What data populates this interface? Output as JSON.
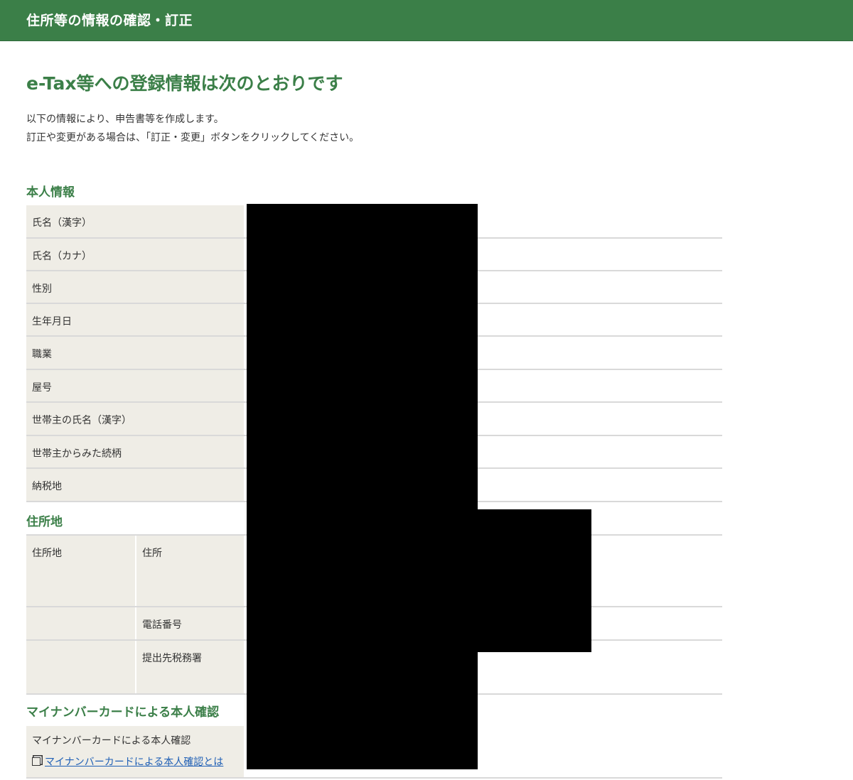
{
  "header": {
    "title": "住所等の情報の確認・訂正"
  },
  "page": {
    "heading": "e-Tax等への登録情報は次のとおりです",
    "intro_lines": [
      "以下の情報により、申告書等を作成します。",
      "訂正や変更がある場合は、「訂正・変更」ボタンをクリックしてください。"
    ]
  },
  "sections": {
    "personal": {
      "title": "本人情報",
      "rows": [
        "氏名（漢字）",
        "氏名（カナ）",
        "性別",
        "生年月日",
        "職業",
        "屋号",
        "世帯主の氏名（漢字）",
        "世帯主からみた続柄",
        "納税地"
      ]
    },
    "address": {
      "title": "住所地",
      "group_label": "住所地",
      "rows": [
        "住所",
        "電話番号",
        "提出先税務署"
      ]
    },
    "mynumber": {
      "title": "マイナンバーカードによる本人確認",
      "row_label": "マイナンバーカードによる本人確認",
      "link_text": "マイナンバーカードによる本人確認とは",
      "link_icon": "window-icon"
    }
  },
  "colors": {
    "brand_green": "#3b7f48",
    "label_bg": "#efede6",
    "link": "#1f5fb5"
  }
}
